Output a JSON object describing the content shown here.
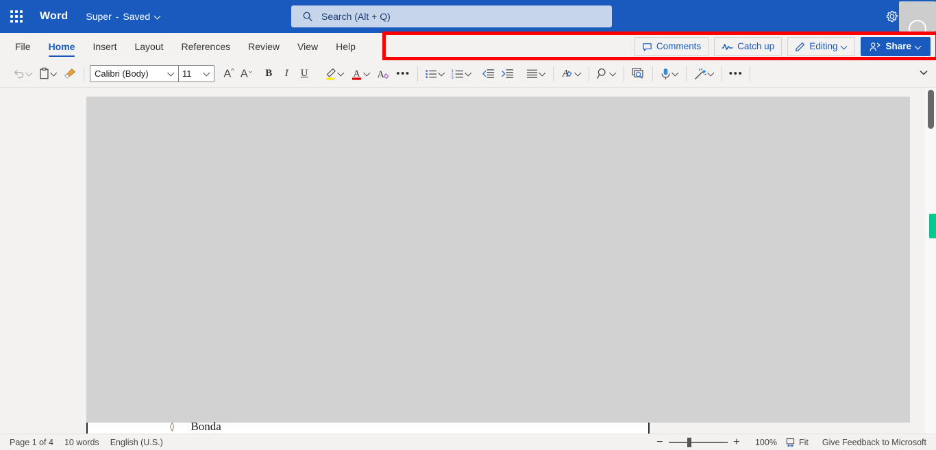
{
  "titlebar": {
    "app_launcher": "app-launcher",
    "brand": "Word",
    "doc_name": "Super",
    "separator": "-",
    "save_state": "Saved",
    "search_placeholder": "Search (Alt + Q)",
    "settings": "Settings",
    "account": "Account"
  },
  "ribbon": {
    "tabs": [
      {
        "label": "File",
        "active": false
      },
      {
        "label": "Home",
        "active": true
      },
      {
        "label": "Insert",
        "active": false
      },
      {
        "label": "Layout",
        "active": false
      },
      {
        "label": "References",
        "active": false
      },
      {
        "label": "Review",
        "active": false
      },
      {
        "label": "View",
        "active": false
      },
      {
        "label": "Help",
        "active": false
      }
    ],
    "comments_label": "Comments",
    "catchup_label": "Catch up",
    "editing_label": "Editing",
    "share_label": "Share"
  },
  "toolbar": {
    "undo": "Undo",
    "paste": "Paste",
    "format_painter": "Format Painter",
    "font_name": "Calibri (Body)",
    "font_size": "11",
    "grow_font": "Grow font",
    "shrink_font": "Shrink font",
    "bold": "B",
    "italic": "I",
    "underline": "U",
    "highlight": "Text Highlight Color",
    "font_color": "Font Color",
    "clear_formatting": "Clear All Formatting",
    "more_font": "•••",
    "bullets": "Bullets",
    "numbering": "Numbering",
    "decrease_indent": "Decrease Indent",
    "increase_indent": "Increase Indent",
    "alignment": "Alignment",
    "styles": "Styles",
    "find": "Find",
    "editor": "Editor",
    "dictate": "Dictate",
    "designer": "Designer",
    "more_commands": "•••",
    "collapse_ribbon": "Collapse ribbon"
  },
  "document": {
    "bullet": "◊",
    "text": "Bonda"
  },
  "annotation": {
    "highlight_color": "#fe0000"
  },
  "statusbar": {
    "page": "Page 1 of 4",
    "words": "10 words",
    "language": "English (U.S.)",
    "zoom_out": "−",
    "zoom_in": "+",
    "zoom_level": "100%",
    "fit_label": "Fit",
    "feedback": "Give Feedback to Microsoft"
  },
  "colors": {
    "brand_blue": "#185abd",
    "search_bg": "#c7d5ea",
    "chrome_bg": "#f3f2f1",
    "page_gray": "#d2d2d2",
    "annotation_red": "#fe0000",
    "presence_green": "#03ca8e"
  }
}
